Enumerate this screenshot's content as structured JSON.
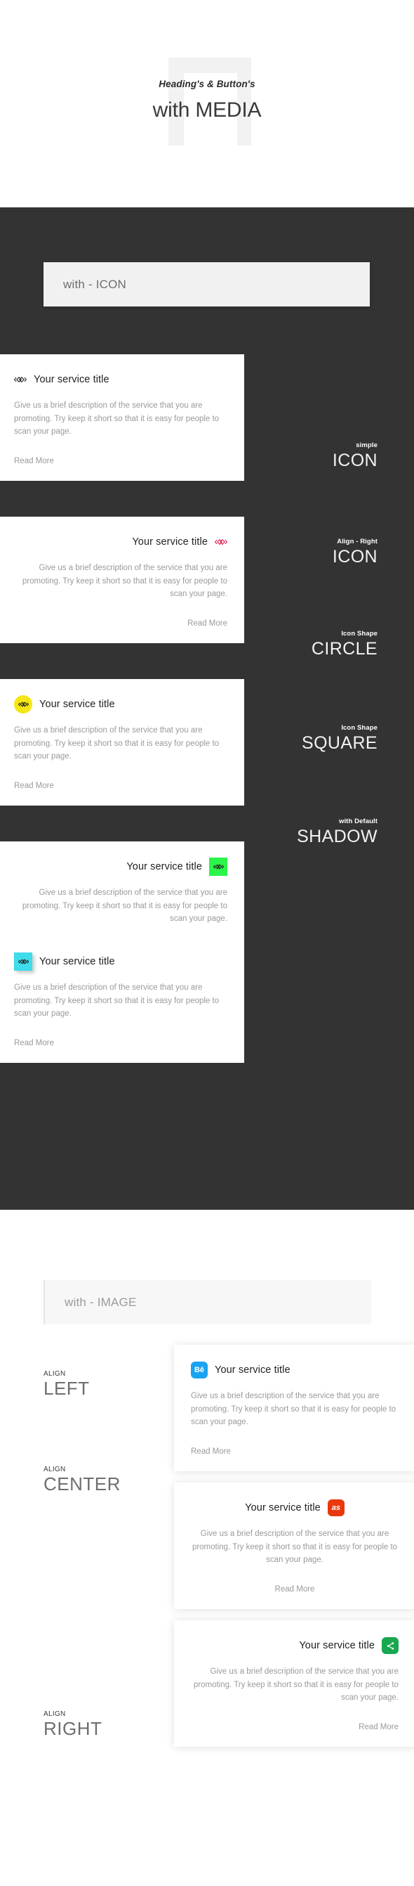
{
  "header": {
    "kicker": "Heading's & Button's",
    "title": "with MEDIA"
  },
  "icon_section": {
    "banner_label": "with - ICON",
    "background_color": "#333333",
    "cards": [
      {
        "title": "Your service title",
        "description": "Give us a brief description of the service that you are promoting. Try keep it short so that it is easy for people to scan your page.",
        "read_more": "Read More",
        "icon_name": "code-diamond-icon",
        "icon_color": "#222222",
        "shape": "bare",
        "align": "left",
        "caption_small": "simple",
        "caption_big": "ICON"
      },
      {
        "title": "Your service title",
        "description": "Give us a brief description of the service that you are promoting. Try keep it short so that it is easy for people to scan your page.",
        "read_more": "Read More",
        "icon_name": "code-diamond-icon",
        "icon_color": "#e8174a",
        "shape": "bare",
        "align": "right",
        "caption_small": "Align - Right",
        "caption_big": "ICON"
      },
      {
        "title": "Your service title",
        "description": "Give us a brief description of the service that you are promoting. Try keep it short so that it is easy for people to scan your page.",
        "read_more": "Read More",
        "icon_name": "code-diamond-icon",
        "icon_color": "#1c1c1c",
        "badge_color": "#f5e618",
        "shape": "circle",
        "align": "left",
        "caption_small": "Icon Shape",
        "caption_big": "CIRCLE"
      },
      {
        "title": "Your service title",
        "description": "Give us a brief description of the service that you are promoting. Try keep it short so that it is easy for people to scan your page.",
        "read_more": "Read More",
        "icon_name": "code-diamond-icon",
        "icon_color": "#1c1c1c",
        "badge_color": "#2bf44a",
        "shape": "square",
        "align": "right",
        "caption_small": "Icon Shape",
        "caption_big": "SQUARE"
      },
      {
        "title": "Your service title",
        "description": "Give us a brief description of the service that you are promoting. Try keep it short so that it is easy for people to scan your page.",
        "read_more": "Read More",
        "icon_name": "code-diamond-icon",
        "icon_color": "#1c1c1c",
        "badge_color": "#3fdcec",
        "shape": "square-shadow",
        "align": "left",
        "caption_small": "with Default",
        "caption_big": "SHADOW"
      }
    ]
  },
  "image_section": {
    "banner_label": "with - IMAGE",
    "background_color": "#ffffff",
    "cards": [
      {
        "title": "Your service title",
        "description": "Give us a brief description of the service that you are promoting. Try keep it short so that it is easy for people to scan your page.",
        "read_more": "Read More",
        "icon_name": "behance-icon",
        "icon_glyph": "Bē",
        "badge_color": "#1aa3ef",
        "align": "left",
        "caption_small": "ALIGN",
        "caption_big": "LEFT"
      },
      {
        "title": "Your service title",
        "description": "Give us a brief description of the service that you are promoting. Try keep it short so that it is easy for people to scan your page.",
        "read_more": "Read More",
        "icon_name": "lastfm-icon",
        "icon_glyph": "as",
        "badge_color": "#e8390c",
        "align": "center",
        "caption_small": "ALIGN",
        "caption_big": "CENTER"
      },
      {
        "title": "Your service title",
        "description": "Give us a brief description of the service that you are promoting. Try keep it short so that it is easy for people to scan your page.",
        "read_more": "Read More",
        "icon_name": "share-icon",
        "icon_glyph": "",
        "badge_color": "#19a750",
        "align": "right",
        "caption_small": "ALIGN",
        "caption_big": "RIGHT"
      }
    ]
  }
}
